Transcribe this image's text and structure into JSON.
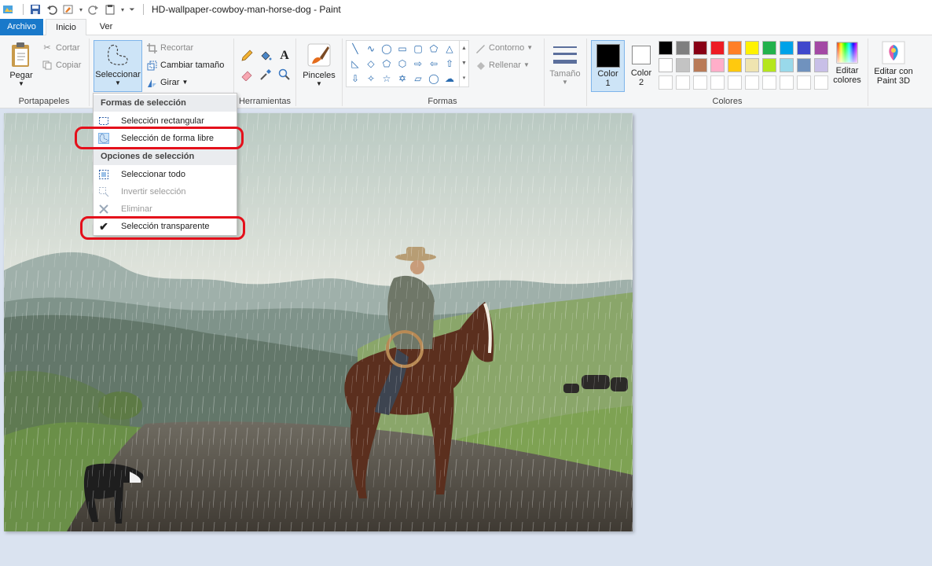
{
  "window": {
    "title": "HD-wallpaper-cowboy-man-horse-dog - Paint"
  },
  "tabs": {
    "file": "Archivo",
    "home": "Inicio",
    "view": "Ver"
  },
  "clipboard": {
    "paste": "Pegar",
    "cut": "Cortar",
    "copy": "Copiar",
    "group": "Portapapeles"
  },
  "image_group": {
    "select": "Seleccionar",
    "crop": "Recortar",
    "resize": "Cambiar tamaño",
    "rotate": "Girar"
  },
  "tools": {
    "group": "Herramientas",
    "brushes": "Pinceles"
  },
  "shapes": {
    "group": "Formas",
    "outline": "Contorno",
    "fill": "Rellenar",
    "size": "Tamaño"
  },
  "colors": {
    "group": "Colores",
    "color1_line1": "Color",
    "color1_line2": "1",
    "color2_line1": "Color",
    "color2_line2": "2",
    "edit_line1": "Editar",
    "edit_line2": "colores",
    "paint3d_line1": "Editar con",
    "paint3d_line2": "Paint 3D",
    "row1": [
      "#000000",
      "#7f7f7f",
      "#880015",
      "#ed1c24",
      "#ff7f27",
      "#fff200",
      "#22b14c",
      "#00a2e8",
      "#3f48cc",
      "#a349a4"
    ],
    "row2": [
      "#ffffff",
      "#c3c3c3",
      "#b97a57",
      "#ffaec9",
      "#ffc90e",
      "#efe4b0",
      "#b5e61d",
      "#99d9ea",
      "#7092be",
      "#c8bfe7"
    ]
  },
  "menu": {
    "section1": "Formas de selección",
    "rect": "Selección rectangular",
    "free": "Selección de forma libre",
    "section2": "Opciones de selección",
    "select_all": "Seleccionar todo",
    "invert": "Invertir selección",
    "delete": "Eliminar",
    "transparent": "Selección transparente"
  }
}
